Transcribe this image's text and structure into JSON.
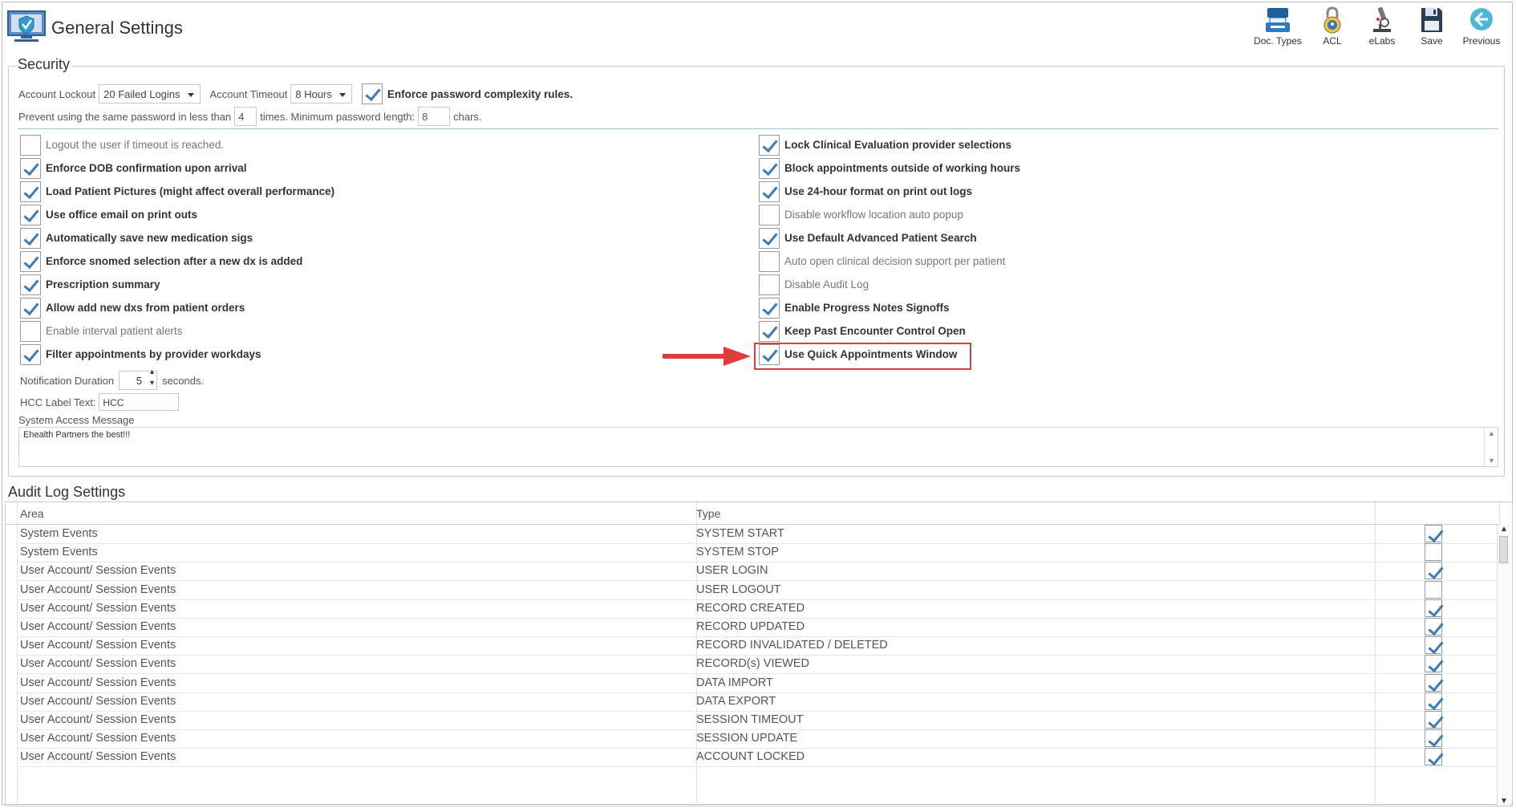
{
  "header": {
    "title": "General Settings",
    "toolbar": [
      {
        "label": "Doc. Types",
        "icon": "doc-types-icon"
      },
      {
        "label": "ACL",
        "icon": "lock-icon"
      },
      {
        "label": "eLabs",
        "icon": "microscope-icon"
      },
      {
        "label": "Save",
        "icon": "save-icon"
      },
      {
        "label": "Previous",
        "icon": "back-arrow-icon"
      }
    ]
  },
  "security": {
    "legend": "Security",
    "account_lockout_label": "Account Lockout",
    "account_lockout_value": "20 Failed Logins",
    "account_timeout_label": "Account Timeout",
    "account_timeout_value": "8 Hours",
    "complexity_label": "Enforce password complexity rules.",
    "complexity_checked": true,
    "prevent_label_1": "Prevent using the same password in less than",
    "prevent_times_value": "4",
    "prevent_label_2": "times. Minimum password length:",
    "min_length_value": "8",
    "prevent_label_3": "chars.",
    "left_options": [
      {
        "label": "Logout the user if timeout is reached.",
        "checked": false
      },
      {
        "label": "Enforce DOB confirmation upon arrival",
        "checked": true
      },
      {
        "label": "Load Patient Pictures (might affect overall performance)",
        "checked": true
      },
      {
        "label": "Use office email on print outs",
        "checked": true
      },
      {
        "label": "Automatically save new medication sigs",
        "checked": true
      },
      {
        "label": "Enforce snomed selection after a new dx is added",
        "checked": true
      },
      {
        "label": "Prescription summary",
        "checked": true
      },
      {
        "label": "Allow add new dxs from patient orders",
        "checked": true
      },
      {
        "label": "Enable interval patient alerts",
        "checked": false
      },
      {
        "label": "Filter appointments by provider workdays",
        "checked": true
      }
    ],
    "right_options": [
      {
        "label": "Lock Clinical Evaluation provider selections",
        "checked": true
      },
      {
        "label": "Block appointments outside of working hours",
        "checked": true
      },
      {
        "label": "Use 24-hour format on print out logs",
        "checked": true
      },
      {
        "label": "Disable workflow location auto popup",
        "checked": false
      },
      {
        "label": "Use Default Advanced Patient Search",
        "checked": true
      },
      {
        "label": "Auto open clinical decision support per patient",
        "checked": false
      },
      {
        "label": "Disable Audit Log",
        "checked": false
      },
      {
        "label": "Enable Progress Notes Signoffs",
        "checked": true
      },
      {
        "label": "Keep Past Encounter Control Open",
        "checked": true
      },
      {
        "label": "Use Quick Appointments Window",
        "checked": true
      }
    ],
    "notification_label": "Notification Duration",
    "notification_value": "5",
    "notification_unit": "seconds.",
    "hcc_label": "HCC Label Text:",
    "hcc_value": "HCC",
    "system_access_label": "System Access Message",
    "system_access_value": "Ehealth Partners the best!!!"
  },
  "audit": {
    "title": "Audit Log Settings",
    "columns": [
      "Area",
      "Type"
    ],
    "rows": [
      {
        "area": "System Events",
        "type": "SYSTEM START",
        "checked": true
      },
      {
        "area": "System Events",
        "type": "SYSTEM STOP",
        "checked": false
      },
      {
        "area": "User Account/ Session Events",
        "type": "USER LOGIN",
        "checked": true
      },
      {
        "area": "User Account/ Session Events",
        "type": "USER LOGOUT",
        "checked": false
      },
      {
        "area": "User Account/ Session Events",
        "type": "RECORD CREATED",
        "checked": true
      },
      {
        "area": "User Account/ Session Events",
        "type": "RECORD UPDATED",
        "checked": true
      },
      {
        "area": "User Account/ Session Events",
        "type": "RECORD INVALIDATED / DELETED",
        "checked": true
      },
      {
        "area": "User Account/ Session Events",
        "type": "RECORD(s) VIEWED",
        "checked": true
      },
      {
        "area": "User Account/ Session Events",
        "type": "DATA IMPORT",
        "checked": true
      },
      {
        "area": "User Account/ Session Events",
        "type": "DATA EXPORT",
        "checked": true
      },
      {
        "area": "User Account/ Session Events",
        "type": "SESSION TIMEOUT",
        "checked": true
      },
      {
        "area": "User Account/ Session Events",
        "type": "SESSION UPDATE",
        "checked": true
      },
      {
        "area": "User Account/ Session Events",
        "type": "ACCOUNT LOCKED",
        "checked": true
      }
    ]
  },
  "colors": {
    "accent": "#3d7ab8",
    "highlight": "#e23b3b"
  }
}
